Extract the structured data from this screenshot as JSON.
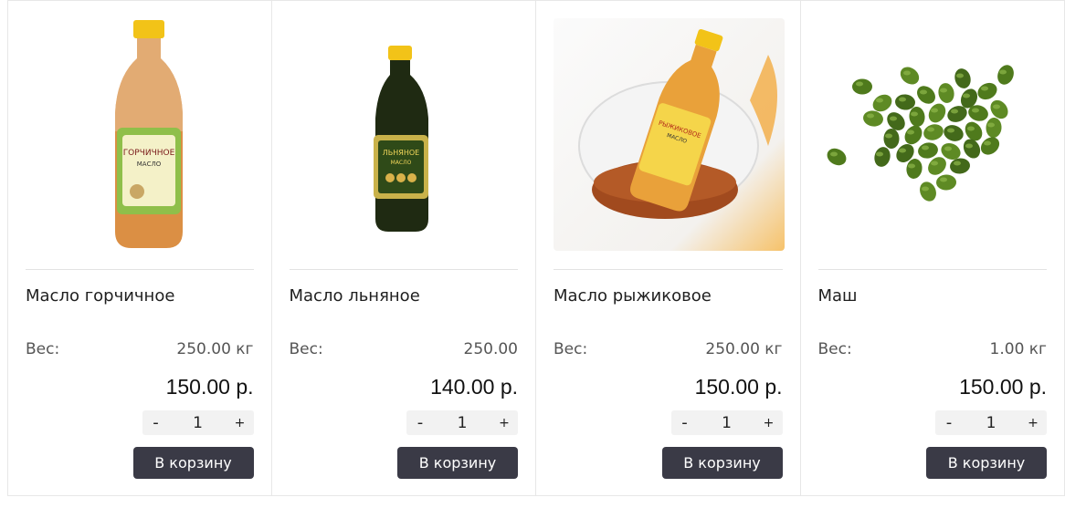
{
  "labels": {
    "weight": "Вес:",
    "buy": "В корзину",
    "minus": "-",
    "plus": "+"
  },
  "products": [
    {
      "name": "Масло горчичное",
      "weight": "250.00 кг",
      "price": "150.00 р.",
      "qty": "1",
      "image_icon": "mustard-oil-bottle-image"
    },
    {
      "name": "Масло льняное",
      "weight": "250.00",
      "price": "140.00 р.",
      "qty": "1",
      "image_icon": "linseed-oil-bottle-image"
    },
    {
      "name": "Масло рыжиковое",
      "weight": "250.00 кг",
      "price": "150.00 р.",
      "qty": "1",
      "image_icon": "camelina-oil-bottle-image"
    },
    {
      "name": "Маш",
      "weight": "1.00 кг",
      "price": "150.00 р.",
      "qty": "1",
      "image_icon": "mung-beans-image"
    }
  ],
  "colors": {
    "button_bg": "#3a3a46",
    "qty_bg": "#f2f2f2",
    "border": "#e7e7e7"
  }
}
